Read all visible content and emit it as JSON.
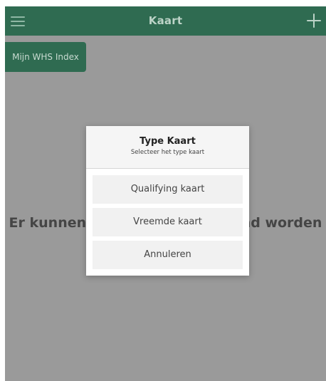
{
  "header": {
    "title": "Kaart",
    "menu_icon": "hamburger-icon",
    "add_icon": "plus-icon"
  },
  "whs_button": {
    "label": "Mijn WHS Index"
  },
  "background_message": "Er kunnen geen kaarten getoond worden",
  "dialog": {
    "title": "Type Kaart",
    "subtitle": "Selecteer het type kaart",
    "options": [
      {
        "label": "Qualifying kaart"
      },
      {
        "label": "Vreemde kaart"
      },
      {
        "label": "Annuleren"
      }
    ]
  },
  "colors": {
    "brand_green": "#2f6b51",
    "overlay_gray": "#9a9a9a",
    "dialog_bg": "#ffffff",
    "option_bg": "#f1f1f1"
  }
}
